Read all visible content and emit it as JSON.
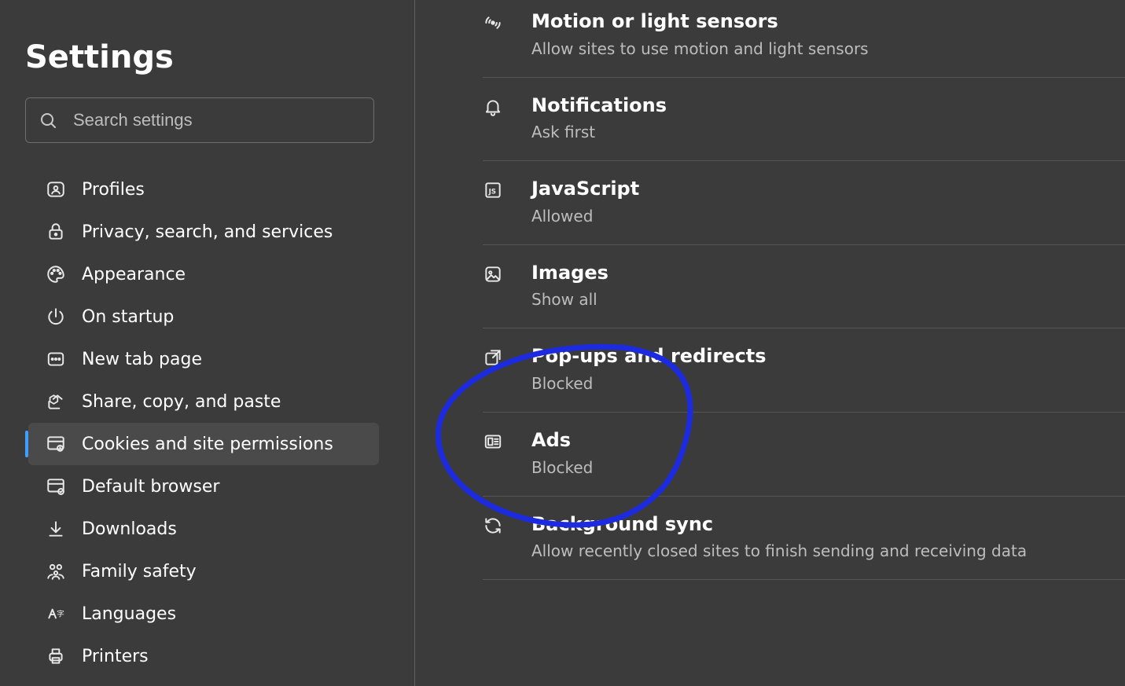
{
  "sidebar": {
    "title": "Settings",
    "search_placeholder": "Search settings",
    "items": [
      {
        "label": "Profiles",
        "active": false
      },
      {
        "label": "Privacy, search, and services",
        "active": false
      },
      {
        "label": "Appearance",
        "active": false
      },
      {
        "label": "On startup",
        "active": false
      },
      {
        "label": "New tab page",
        "active": false
      },
      {
        "label": "Share, copy, and paste",
        "active": false
      },
      {
        "label": "Cookies and site permissions",
        "active": true
      },
      {
        "label": "Default browser",
        "active": false
      },
      {
        "label": "Downloads",
        "active": false
      },
      {
        "label": "Family safety",
        "active": false
      },
      {
        "label": "Languages",
        "active": false
      },
      {
        "label": "Printers",
        "active": false
      }
    ]
  },
  "permissions": [
    {
      "title": "Motion or light sensors",
      "desc": "Allow sites to use motion and light sensors"
    },
    {
      "title": "Notifications",
      "desc": "Ask first"
    },
    {
      "title": "JavaScript",
      "desc": "Allowed"
    },
    {
      "title": "Images",
      "desc": "Show all"
    },
    {
      "title": "Pop-ups and redirects",
      "desc": "Blocked"
    },
    {
      "title": "Ads",
      "desc": "Blocked"
    },
    {
      "title": "Background sync",
      "desc": "Allow recently closed sites to finish sending and receiving data"
    }
  ],
  "annotation": {
    "type": "hand-drawn-circle",
    "color": "#1d2be0",
    "highlights": "Pop-ups and redirects"
  }
}
